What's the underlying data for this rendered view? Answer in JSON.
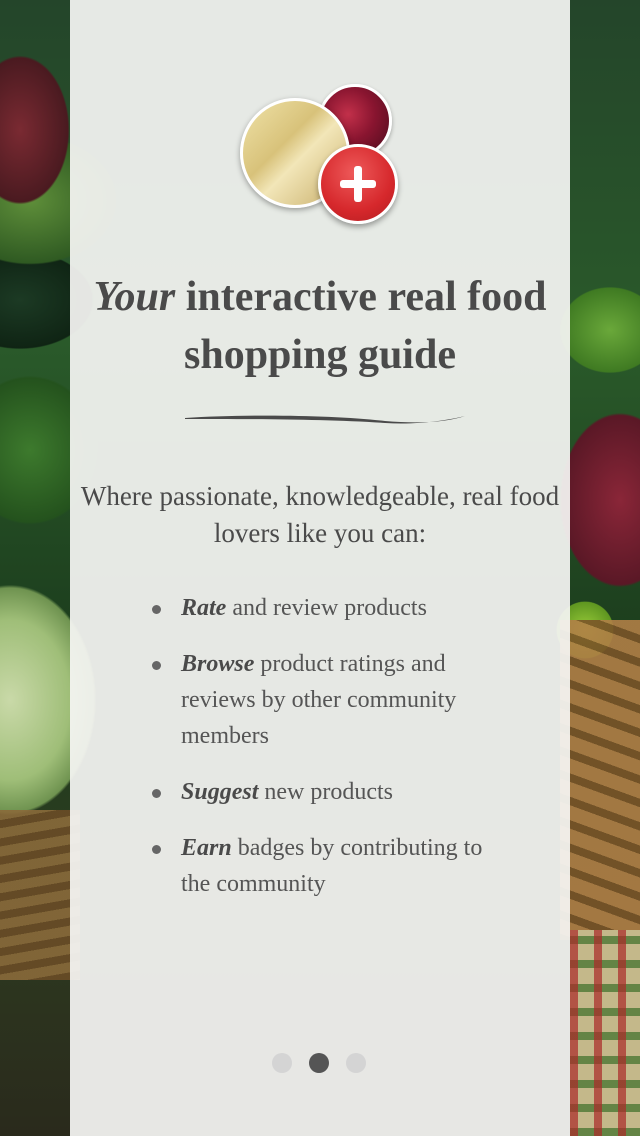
{
  "hero": {
    "icon": "add-food-icon"
  },
  "headline": {
    "emphasis": "Your",
    "rest": " interactive real food shopping guide"
  },
  "intro": "Where passionate, knowledgeable, real food lovers like you can:",
  "features": [
    {
      "emphasis": "Rate",
      "text": " and review products"
    },
    {
      "emphasis": "Browse",
      "text": " product ratings and reviews by other community members"
    },
    {
      "emphasis": "Suggest",
      "text": " new products"
    },
    {
      "emphasis": "Earn",
      "text": " badges by contributing to the community"
    }
  ],
  "pager": {
    "count": 3,
    "active": 2
  },
  "colors": {
    "accent": "#d6282c",
    "text": "#4a4a4a",
    "panel": "#f5f5f3"
  }
}
